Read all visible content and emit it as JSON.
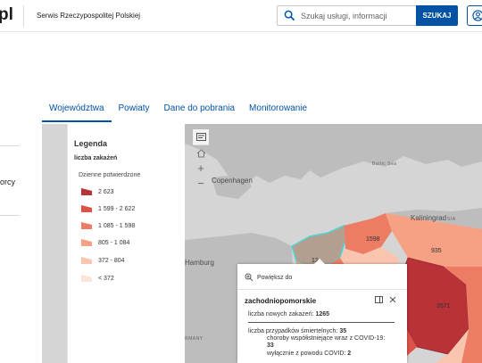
{
  "header": {
    "logo_fragment": "pl",
    "site_name": "Serwis Rzeczypospolitej Polskiej",
    "search_placeholder": "Szukaj usługi, informacji",
    "search_button": "SZUKAJ"
  },
  "left_panel": {
    "fragment": "orcy"
  },
  "tabs": [
    {
      "label": "Województwa",
      "active": true
    },
    {
      "label": "Powiaty",
      "active": false
    },
    {
      "label": "Dane do pobrania",
      "active": false
    },
    {
      "label": "Monitorowanie",
      "active": false
    }
  ],
  "map": {
    "places": [
      "Copenhagen",
      "Kaliningrad",
      "Hamburg",
      "Baltic Sea",
      "RMANY",
      "SIA"
    ],
    "region_values": [
      "1598",
      "935",
      "12",
      "3571"
    ],
    "colors": {
      "land": "#bdbdbd",
      "sea": "#d5d5d5",
      "selected": "#b39f90",
      "outline": "#4fd6d6"
    }
  },
  "legend": {
    "title": "Legenda",
    "layer": "liczba zakażeń",
    "subtitle": "Dzienne potwierdzone",
    "classes": [
      {
        "label": "2 623",
        "color": "#b83238"
      },
      {
        "label": "1 599 - 2 622",
        "color": "#dd5248"
      },
      {
        "label": "1 085 - 1 598",
        "color": "#ed7c64"
      },
      {
        "label": "805 - 1 084",
        "color": "#f6a184"
      },
      {
        "label": "372 - 804",
        "color": "#f9c5ae"
      },
      {
        "label": "< 372",
        "color": "#fde4d9"
      }
    ]
  },
  "popup": {
    "zoom_label": "Powiększ do",
    "region": "zachodniopomorskie",
    "new_cases_label": "liczba nowych zakażeń:",
    "new_cases_value": "1265",
    "deaths_label": "liczba przypadków śmiertelnych:",
    "deaths_value": "35",
    "comorbid_label": "choroby współistniejące wraz z COVID-19:",
    "comorbid_value": "33",
    "covid_only_label": "wyłącznie z powodu COVID:",
    "covid_only_value": "2"
  }
}
